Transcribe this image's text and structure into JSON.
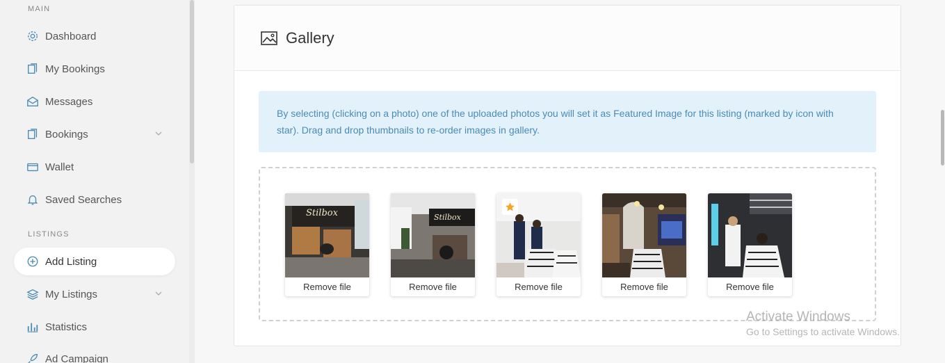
{
  "sidebar": {
    "sections": {
      "main": "MAIN",
      "listings": "LISTINGS"
    },
    "items": [
      {
        "label": "Dashboard",
        "icon": "gear-icon"
      },
      {
        "label": "My Bookings",
        "icon": "documents-icon"
      },
      {
        "label": "Messages",
        "icon": "envelope-icon"
      },
      {
        "label": "Bookings",
        "icon": "documents-icon"
      },
      {
        "label": "Wallet",
        "icon": "wallet-icon"
      },
      {
        "label": "Saved Searches",
        "icon": "bell-icon"
      },
      {
        "label": "Add Listing",
        "icon": "plus-circle-icon"
      },
      {
        "label": "My Listings",
        "icon": "layers-icon"
      },
      {
        "label": "Statistics",
        "icon": "bar-chart-icon"
      },
      {
        "label": "Ad Campaign",
        "icon": "rocket-icon"
      }
    ]
  },
  "gallery": {
    "title": "Gallery",
    "notice": "By selecting (clicking on a photo) one of the uploaded photos you will set it as Featured Image for this listing (marked by icon with star). Drag and drop thumbnails to re-order images in gallery.",
    "remove_label": "Remove file",
    "featured_index": 2
  },
  "watermark": {
    "line1": "Activate Windows",
    "line2": "Go to Settings to activate Windows."
  },
  "colors": {
    "accent": "#4a8bb5",
    "notice_bg": "#e3f1fb",
    "star": "#f5a623"
  }
}
